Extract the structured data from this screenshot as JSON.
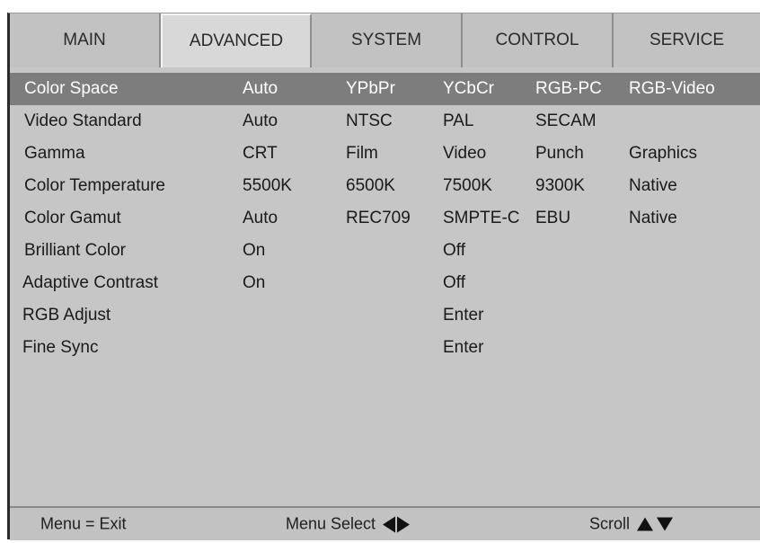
{
  "tabs": {
    "main": "MAIN",
    "advanced": "ADVANCED",
    "system": "SYSTEM",
    "control": "CONTROL",
    "service": "SERVICE",
    "active": "advanced"
  },
  "rows": [
    {
      "label": "Color Space",
      "options": [
        "Auto",
        "YPbPr",
        "YCbCr",
        "RGB-PC",
        "RGB-Video"
      ],
      "selected": true
    },
    {
      "label": "Video Standard",
      "options": [
        "Auto",
        "NTSC",
        "PAL",
        "SECAM",
        ""
      ]
    },
    {
      "label": "Gamma",
      "options": [
        "CRT",
        "Film",
        "Video",
        "Punch",
        "Graphics"
      ]
    },
    {
      "label": "Color Temperature",
      "options": [
        "5500K",
        "6500K",
        "7500K",
        "9300K",
        "Native"
      ]
    },
    {
      "label": "Color Gamut",
      "options": [
        "Auto",
        "REC709",
        "SMPTE-C",
        "EBU",
        "Native"
      ]
    },
    {
      "label": "Brilliant Color",
      "options": [
        "On",
        "",
        "Off",
        "",
        ""
      ]
    },
    {
      "label": "Adaptive Contrast",
      "options": [
        "On",
        "",
        "Off",
        "",
        ""
      ]
    },
    {
      "label": "RGB Adjust",
      "options": [
        "",
        "",
        "Enter",
        "",
        ""
      ]
    },
    {
      "label": "Fine Sync",
      "options": [
        "",
        "",
        "Enter",
        "",
        ""
      ]
    }
  ],
  "footer": {
    "exit": "Menu = Exit",
    "select": "Menu Select",
    "scroll": "Scroll"
  },
  "icons": {
    "select": [
      "triangle-left-icon",
      "triangle-right-icon"
    ],
    "scroll": [
      "triangle-up-icon",
      "triangle-down-icon"
    ]
  },
  "colors": {
    "panel": "#c6c6c6",
    "highlight": "#7d7d7d",
    "active_tab": "#d8d8d8"
  }
}
